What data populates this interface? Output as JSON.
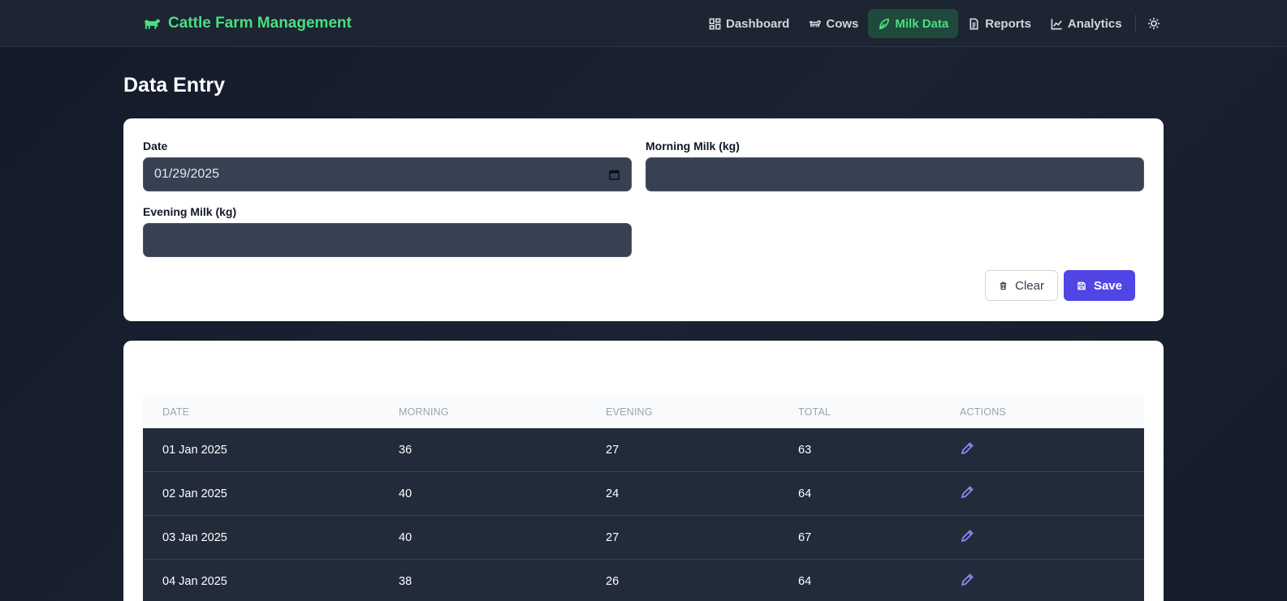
{
  "app": {
    "title": "Cattle Farm Management",
    "icon": "cow-icon",
    "accent_color": "#4ade80"
  },
  "nav": {
    "items": [
      {
        "label": "Dashboard",
        "icon": "grid-icon",
        "active": false
      },
      {
        "label": "Cows",
        "icon": "cow-icon",
        "active": false
      },
      {
        "label": "Milk Data",
        "icon": "milk-icon",
        "active": true
      },
      {
        "label": "Reports",
        "icon": "document-icon",
        "active": false
      },
      {
        "label": "Analytics",
        "icon": "chart-line-icon",
        "active": false
      }
    ],
    "theme_toggle_icon": "sun-icon"
  },
  "page": {
    "title": "Data Entry"
  },
  "form": {
    "date_label": "Date",
    "date_value": "01/29/2025",
    "morning_label": "Morning Milk (kg)",
    "morning_value": "",
    "evening_label": "Evening Milk (kg)",
    "evening_value": "",
    "clear_label": "Clear",
    "save_label": "Save",
    "save_color": "#4f46e5"
  },
  "table": {
    "headers": [
      "DATE",
      "MORNING",
      "EVENING",
      "TOTAL",
      "ACTIONS"
    ],
    "rows": [
      {
        "date": "01 Jan 2025",
        "morning": "36",
        "evening": "27",
        "total": "63"
      },
      {
        "date": "02 Jan 2025",
        "morning": "40",
        "evening": "24",
        "total": "64"
      },
      {
        "date": "03 Jan 2025",
        "morning": "40",
        "evening": "27",
        "total": "67"
      },
      {
        "date": "04 Jan 2025",
        "morning": "38",
        "evening": "26",
        "total": "64"
      }
    ]
  }
}
